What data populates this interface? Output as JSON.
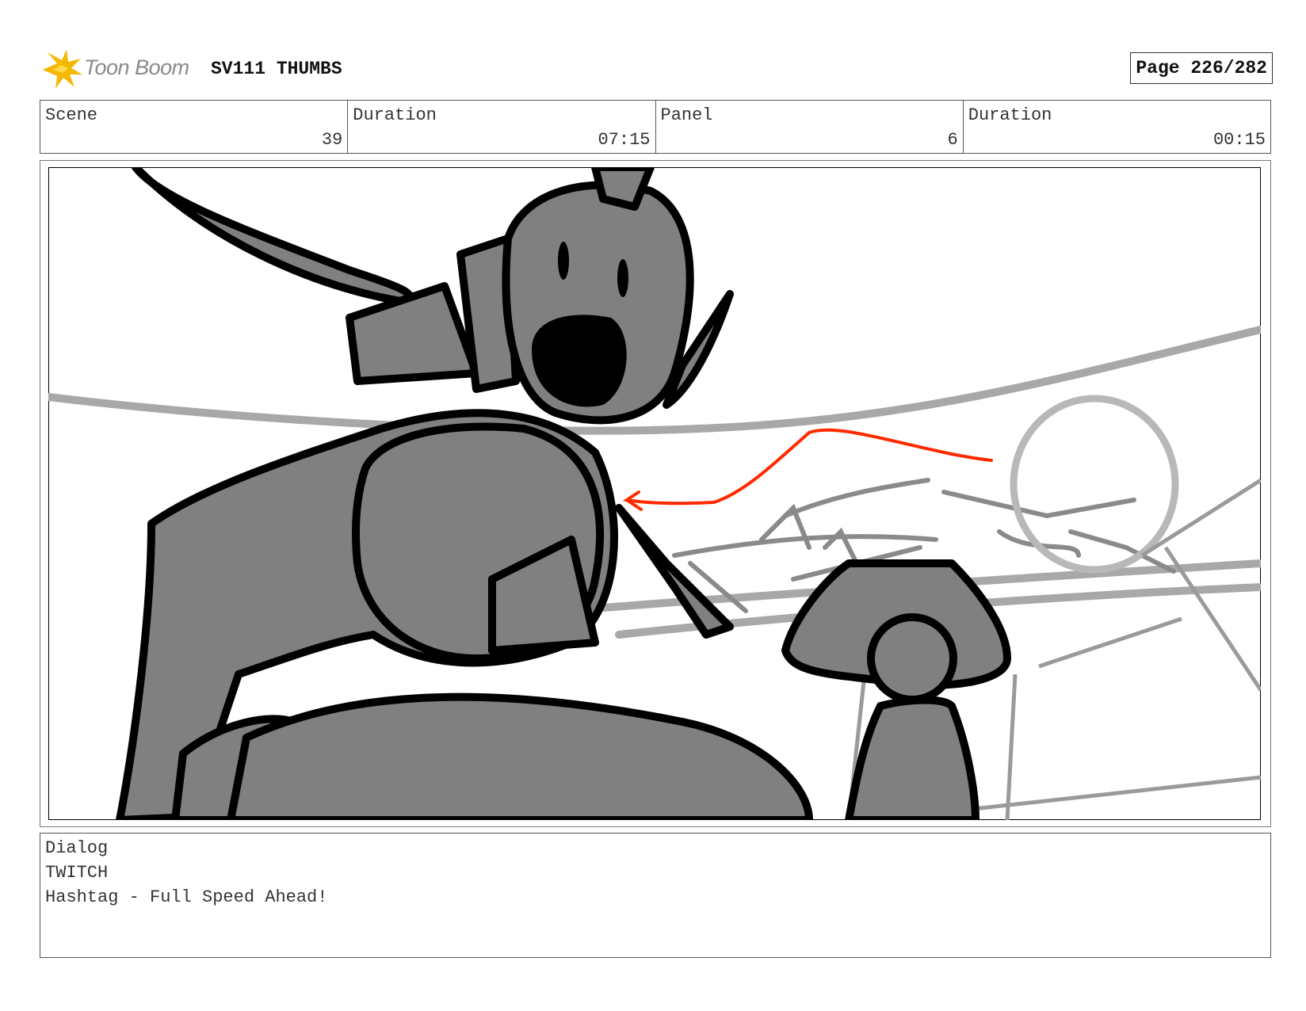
{
  "header": {
    "logo_text": "Toon Boom",
    "project": "SV111 THUMBS",
    "page": "Page 226/282"
  },
  "info": {
    "scene_label": "Scene",
    "scene_value": "39",
    "scene_duration_label": "Duration",
    "scene_duration_value": "07:15",
    "panel_label": "Panel",
    "panel_value": "6",
    "panel_duration_label": "Duration",
    "panel_duration_value": "00:15"
  },
  "dialog": {
    "label": "Dialog",
    "character": "TWITCH",
    "line": "Hashtag - Full Speed Ahead!"
  },
  "colors": {
    "fill_gray": "#808080",
    "ink": "#000000",
    "guide_gray": "#a8a8a8",
    "arrow_red": "#ff2a00",
    "logo_yellow": "#f5b800"
  }
}
